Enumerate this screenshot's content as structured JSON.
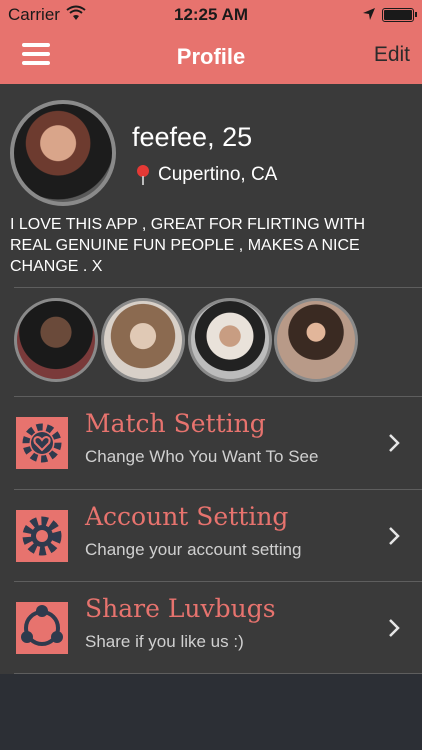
{
  "status_bar": {
    "carrier": "Carrier",
    "time": "12:25 AM",
    "icons": [
      "wifi-icon",
      "location-arrow-icon",
      "battery-icon"
    ]
  },
  "nav": {
    "menu_icon": "hamburger-menu-icon",
    "title": "Profile",
    "edit_label": "Edit"
  },
  "profile": {
    "name": "feefee, 25",
    "location": "Cupertino, CA",
    "bio": "I LOVE THIS APP , GREAT FOR FLIRTING WITH REAL GENUINE FUN PEOPLE , MAKES A NICE CHANGE . X"
  },
  "photos_count": 4,
  "menu": [
    {
      "title": "Match Setting",
      "subtitle": "Change Who You Want To See",
      "icon": "heart-gear-icon"
    },
    {
      "title": "Account Setting",
      "subtitle": "Change your account setting",
      "icon": "gear-icon"
    },
    {
      "title": "Share Luvbugs",
      "subtitle": "Share if you like us :)",
      "icon": "share-icon"
    }
  ],
  "colors": {
    "accent": "#e7736e",
    "background": "#3a3a3a",
    "icon_dark": "#2f3a4d"
  }
}
